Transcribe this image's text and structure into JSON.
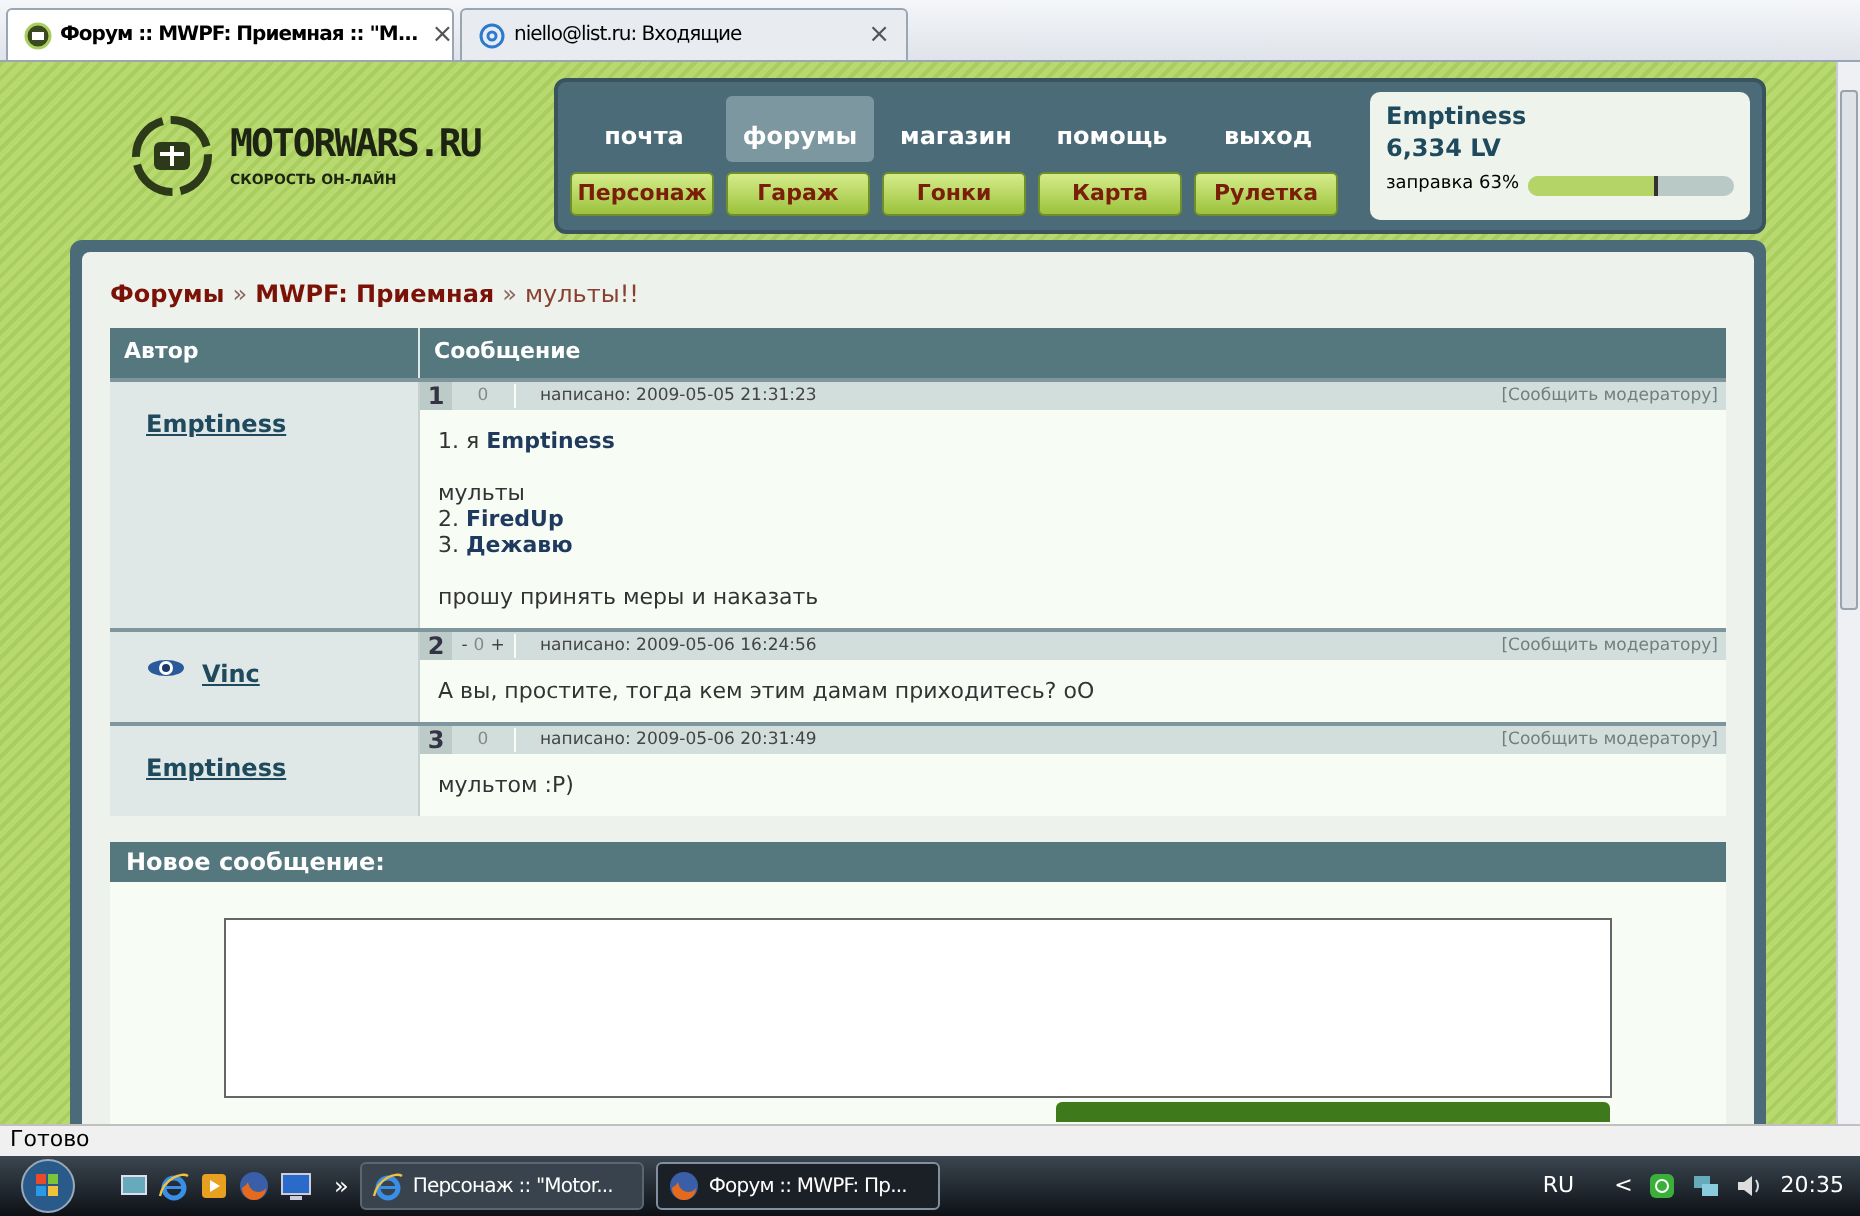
{
  "browser_tabs": [
    {
      "title": "Форум :: MWPF: Приемная :: \"M...",
      "close": "×",
      "selected": true
    },
    {
      "title": "niello@list.ru: Входящие",
      "close": "×",
      "selected": false
    }
  ],
  "logo": {
    "name": "MOTORWARS.RU",
    "tagline": "СКОРОСТЬ ОН-ЛАЙН"
  },
  "nav": {
    "top_links": [
      {
        "label": "почта",
        "selected": false
      },
      {
        "label": "форумы",
        "selected": true
      },
      {
        "label": "магазин",
        "selected": false
      },
      {
        "label": "помощь",
        "selected": false
      },
      {
        "label": "выход",
        "selected": false
      }
    ],
    "buttons": [
      "Персонаж",
      "Гараж",
      "Гонки",
      "Карта",
      "Рулетка"
    ]
  },
  "user": {
    "name": "Emptiness",
    "lv": "6,334 LV",
    "fuel_label": "заправка 63%",
    "level": 0.63
  },
  "breadcrumb": {
    "links": [
      "Форумы",
      "MWPF: Приемная"
    ],
    "separator": "»",
    "current": "мульты!!"
  },
  "table": {
    "columns": [
      "Автор",
      "Сообщение"
    ],
    "posts": [
      {
        "number": "1",
        "rating": "0",
        "date": "написано: 2009-05-05 21:31:23",
        "report": "[Сообщить модератору]",
        "author": "Emptiness",
        "author_badge": false,
        "paragraphs": [
          [
            "1. я **Emptiness**"
          ],
          [
            "мульты",
            "2. **FiredUp**",
            "3. **Дежавю**"
          ],
          [
            "прошу принять меры и наказать"
          ]
        ]
      },
      {
        "number": "2",
        "rating": "0",
        "vote_minus": "-",
        "vote_plus": "+",
        "date": "написано: 2009-05-06 16:24:56",
        "report": "[Сообщить модератору]",
        "author": "Vinc",
        "author_badge": true,
        "paragraphs": [
          [
            "А вы, простите, тогда кем этим дамам приходитесь? oO"
          ]
        ]
      },
      {
        "number": "3",
        "rating": "0",
        "date": "написано: 2009-05-06 20:31:49",
        "report": "[Сообщить модератору]",
        "author": "Emptiness",
        "author_badge": false,
        "paragraphs": [
          [
            "мультом :P)"
          ]
        ]
      }
    ]
  },
  "new_message": {
    "title": "Новое сообщение:"
  },
  "status_bar": "Готово",
  "taskbar": {
    "more": "»",
    "tasks": [
      {
        "label": "Персонаж :: \"Motor...",
        "kind": "ie",
        "selected": false
      },
      {
        "label": "Форум :: MWPF: Пр...",
        "kind": "firefox",
        "selected": true
      }
    ],
    "language": "RU",
    "tray_arrow": "<",
    "time": "20:35"
  }
}
